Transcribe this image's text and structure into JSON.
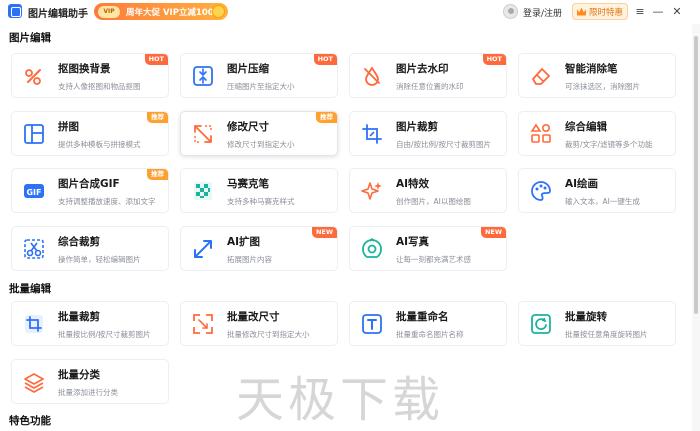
{
  "window": {
    "title": "图片编辑助手",
    "promo_badge": "VIP",
    "promo_text": "周年大促 VIP立减100元",
    "login_label": "登录/注册",
    "vip_label": "限时特惠",
    "menu_glyph": "≡",
    "min_glyph": "—",
    "close_glyph": "✕"
  },
  "sections": {
    "edit": "图片编辑",
    "batch": "批量编辑",
    "special": "特色功能"
  },
  "cards": [
    {
      "title": "抠图换背景",
      "desc": "支持人像抠图和物品抠图",
      "tag": "HOT",
      "icon": "cutout-icon"
    },
    {
      "title": "图片压缩",
      "desc": "压缩图片至指定大小",
      "tag": "HOT",
      "icon": "compress-icon"
    },
    {
      "title": "图片去水印",
      "desc": "消除任意位置的水印",
      "tag": "HOT",
      "icon": "remove-watermark-icon"
    },
    {
      "title": "智能消除笔",
      "desc": "可涂抹选区，消除图片",
      "tag": "",
      "icon": "eraser-icon"
    },
    {
      "title": "拼图",
      "desc": "提供多种模板与拼接模式",
      "tag": "推荐",
      "icon": "collage-icon"
    },
    {
      "title": "修改尺寸",
      "desc": "修改尺寸到指定大小",
      "tag": "推荐",
      "icon": "resize-icon"
    },
    {
      "title": "图片裁剪",
      "desc": "自由/按比例/按尺寸裁剪图片",
      "tag": "",
      "icon": "crop-icon"
    },
    {
      "title": "综合编辑",
      "desc": "裁剪/文字/滤镜等多个功能",
      "tag": "",
      "icon": "composite-edit-icon"
    },
    {
      "title": "图片合成GIF",
      "desc": "支持调整播放速度、添加文字",
      "tag": "推荐",
      "icon": "gif-icon"
    },
    {
      "title": "马赛克笔",
      "desc": "支持多种马赛克样式",
      "tag": "",
      "icon": "mosaic-icon"
    },
    {
      "title": "AI特效",
      "desc": "创作图片，AI以图绘图",
      "tag": "",
      "icon": "ai-effect-icon"
    },
    {
      "title": "AI绘画",
      "desc": "输入文本，AI一键生成",
      "tag": "",
      "icon": "ai-paint-icon"
    },
    {
      "title": "综合裁剪",
      "desc": "操作简单，轻松编辑图片",
      "tag": "",
      "icon": "composite-crop-icon"
    },
    {
      "title": "AI扩图",
      "desc": "拓展图片内容",
      "tag": "NEW",
      "icon": "ai-expand-icon"
    },
    {
      "title": "AI写真",
      "desc": "让每一刻都充满艺术感",
      "tag": "NEW",
      "icon": "ai-portrait-icon"
    }
  ],
  "batch_cards": [
    {
      "title": "批量裁剪",
      "desc": "批量按比例/按尺寸裁剪图片",
      "icon": "batch-crop-icon"
    },
    {
      "title": "批量改尺寸",
      "desc": "批量修改尺寸到指定大小",
      "icon": "batch-resize-icon"
    },
    {
      "title": "批量重命名",
      "desc": "批量重命名图片名称",
      "icon": "batch-rename-icon"
    },
    {
      "title": "批量旋转",
      "desc": "批量按任意角度旋转图片",
      "icon": "batch-rotate-icon"
    },
    {
      "title": "批量分类",
      "desc": "批量添加进行分类",
      "icon": "batch-classify-icon"
    }
  ],
  "watermark": "天极下载",
  "colors": {
    "accent": "#2d72f5",
    "tag_hot": "#ff6a3d",
    "tag_rec": "#ff9f2e",
    "vip": "#e0730f"
  }
}
